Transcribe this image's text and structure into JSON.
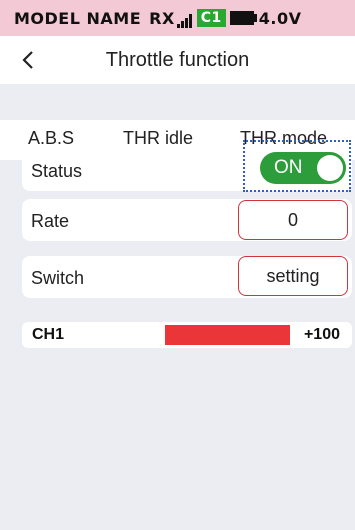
{
  "status_bar": {
    "model_name": "MODEL NAME",
    "rx_label": "RX",
    "signal_icon": "signal-bars-icon",
    "channel_badge": "C1",
    "battery_icon": "battery-icon",
    "voltage": "4.0V",
    "background": "#f3c9d6"
  },
  "header": {
    "back_icon": "chevron-left-icon",
    "title": "Throttle function"
  },
  "tabs": [
    {
      "label": "A.B.S",
      "active": false
    },
    {
      "label": "THR idle",
      "active": true
    },
    {
      "label": "THR mode",
      "active": false
    }
  ],
  "settings": {
    "status": {
      "label": "Status",
      "value": "ON",
      "enabled": true
    },
    "rate": {
      "label": "Rate",
      "value": "0"
    },
    "switch": {
      "label": "Switch",
      "value": "setting"
    }
  },
  "channel": {
    "label": "CH1",
    "value": "+100",
    "fill_fraction": 1.0,
    "bar_color": "#ea3539"
  },
  "colors": {
    "accent_red": "#e0383e",
    "toggle_green": "#2d9c3a",
    "badge_green": "#29a833",
    "focus_blue": "#2d5fc4",
    "background": "#ececf3"
  }
}
